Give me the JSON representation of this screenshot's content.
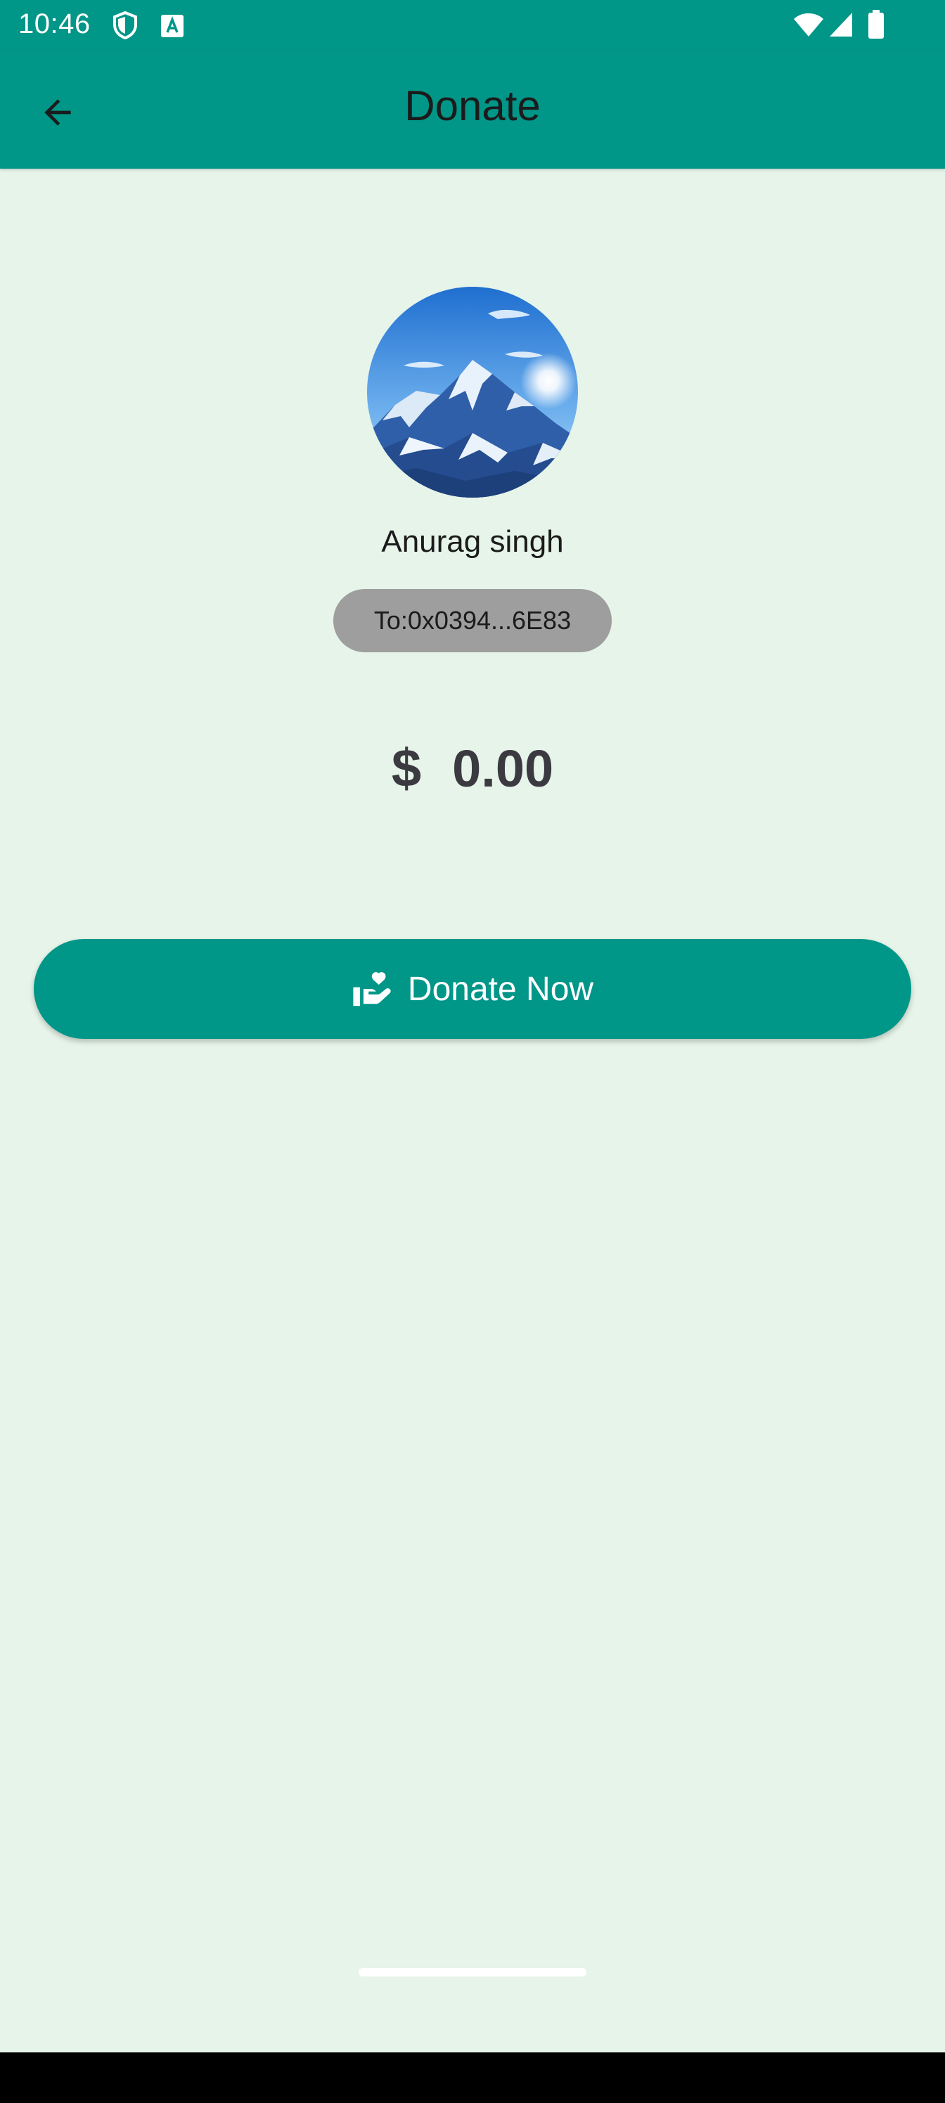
{
  "status_bar": {
    "time": "10:46",
    "icons": [
      "shield-icon",
      "text-a-icon",
      "wifi-icon",
      "cell-signal-icon",
      "battery-icon"
    ]
  },
  "app_bar": {
    "title": "Donate",
    "back_icon": "arrow-back-icon"
  },
  "recipient": {
    "avatar": "mountain-landscape-image",
    "name": "Anurag singh",
    "address_chip": "To:0x0394...6E83"
  },
  "amount": {
    "currency": "$",
    "value": "0.00"
  },
  "donate_button": {
    "icon": "hand-heart-icon",
    "label": "Donate Now"
  },
  "colors": {
    "primary": "#009688",
    "background": "#e6f4e9",
    "chip": "#9e9e9e",
    "text": "#1b1b1b"
  }
}
